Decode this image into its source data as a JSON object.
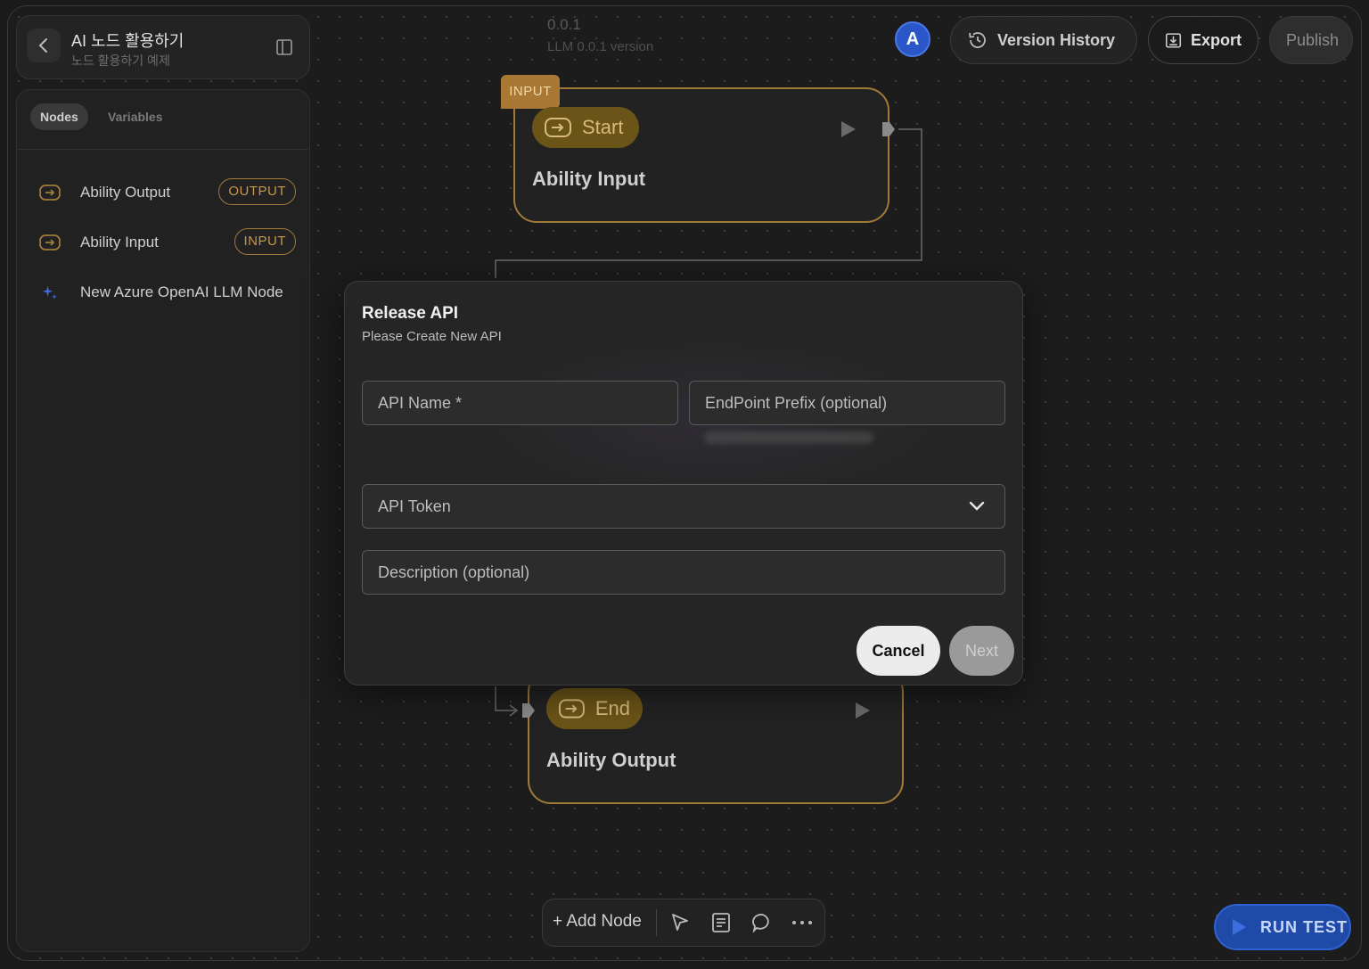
{
  "project": {
    "title": "AI 노드 활용하기",
    "subtitle": "노드 활용하기 예제"
  },
  "sidebar": {
    "tabs": [
      "Nodes",
      "Variables"
    ],
    "items": [
      {
        "label": "Ability Output",
        "badge": "OUTPUT",
        "icon": "io-arrow-icon"
      },
      {
        "label": "Ability Input",
        "badge": "INPUT",
        "icon": "io-arrow-icon"
      },
      {
        "label": "New Azure OpenAI LLM Node",
        "badge": "",
        "icon": "sparkle-icon"
      }
    ]
  },
  "version": {
    "number": "0.0.1",
    "label": "LLM 0.0.1 version"
  },
  "header": {
    "avatar": "A",
    "version_history": "Version History",
    "export": "Export",
    "publish": "Publish"
  },
  "canvas": {
    "start_node": {
      "tag": "INPUT",
      "pill": "Start",
      "title": "Ability Input"
    },
    "end_node": {
      "pill": "End",
      "title": "Ability Output"
    }
  },
  "modal": {
    "title": "Release API",
    "subtitle": "Please Create New API",
    "api_name_placeholder": "API Name *",
    "endpoint_placeholder": "EndPoint Prefix (optional)",
    "token_select": "API Token",
    "description_placeholder": "Description (optional)",
    "cancel": "Cancel",
    "next": "Next"
  },
  "toolbar": {
    "add_node": "+ Add Node"
  },
  "run_test": "RUN TEST",
  "colors": {
    "accent_gold": "#a07a38",
    "run_blue": "#1f4aa8",
    "avatar_blue": "#2a56c8"
  }
}
